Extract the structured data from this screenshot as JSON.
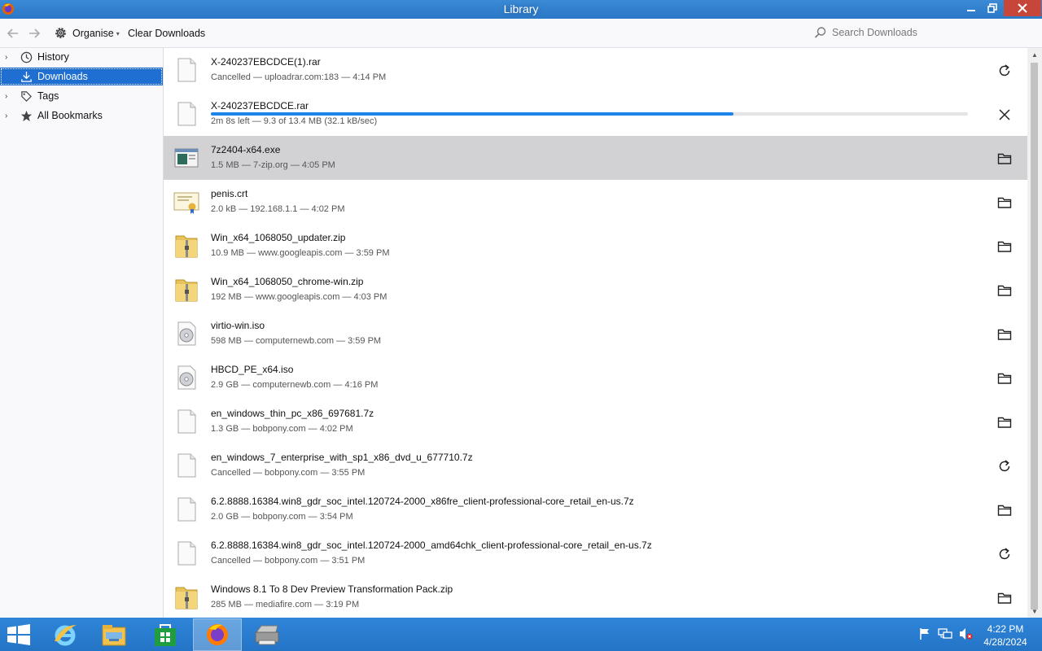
{
  "window": {
    "title": "Library",
    "icon": "firefox-icon",
    "controls": [
      "minimize-icon",
      "maximize-icon",
      "close-icon"
    ]
  },
  "toolbar": {
    "back_icon": "back-arrow-icon",
    "forward_icon": "forward-arrow-icon",
    "organise_label": "Organise",
    "clear_downloads_label": "Clear Downloads",
    "search_placeholder": "Search Downloads"
  },
  "sidebar": {
    "items": [
      {
        "label": "History",
        "icon": "clock-icon",
        "expandable": true,
        "selected": false
      },
      {
        "label": "Downloads",
        "icon": "download-icon",
        "expandable": false,
        "selected": true
      },
      {
        "label": "Tags",
        "icon": "tag-icon",
        "expandable": true,
        "selected": false
      },
      {
        "label": "All Bookmarks",
        "icon": "star-icon",
        "expandable": true,
        "selected": false
      }
    ]
  },
  "downloads": [
    {
      "name": "X-240237EBCDCE(1).rar",
      "status": "Cancelled — uploadrar.com:183 — 4:14 PM",
      "file_icon": "generic-file-icon",
      "action": "retry-icon"
    },
    {
      "name": "X-240237EBCDCE.rar",
      "status": "2m 8s left — 9.3 of 13.4 MB (32.1 kB/sec)",
      "file_icon": "generic-file-icon",
      "action": "cancel-icon",
      "progress": 0.69
    },
    {
      "name": "7z2404-x64.exe",
      "status": "1.5 MB — 7-zip.org — 4:05 PM",
      "file_icon": "exe-file-icon",
      "action": "folder-icon",
      "highlighted": true
    },
    {
      "name": "penis.crt",
      "status": "2.0 kB — 192.168.1.1 — 4:02 PM",
      "file_icon": "certificate-file-icon",
      "action": "folder-icon"
    },
    {
      "name": "Win_x64_1068050_updater.zip",
      "status": "10.9 MB — www.googleapis.com — 3:59 PM",
      "file_icon": "zip-folder-icon",
      "action": "folder-icon"
    },
    {
      "name": "Win_x64_1068050_chrome-win.zip",
      "status": "192 MB — www.googleapis.com — 4:03 PM",
      "file_icon": "zip-folder-icon",
      "action": "folder-icon"
    },
    {
      "name": "virtio-win.iso",
      "status": "598 MB — computernewb.com — 3:59 PM",
      "file_icon": "disc-image-icon",
      "action": "folder-icon"
    },
    {
      "name": "HBCD_PE_x64.iso",
      "status": "2.9 GB — computernewb.com — 4:16 PM",
      "file_icon": "disc-image-icon",
      "action": "folder-icon"
    },
    {
      "name": "en_windows_thin_pc_x86_697681.7z",
      "status": "1.3 GB — bobpony.com — 4:02 PM",
      "file_icon": "generic-file-icon",
      "action": "folder-icon"
    },
    {
      "name": "en_windows_7_enterprise_with_sp1_x86_dvd_u_677710.7z",
      "status": "Cancelled — bobpony.com — 3:55 PM",
      "file_icon": "generic-file-icon",
      "action": "retry-icon"
    },
    {
      "name": "6.2.8888.16384.win8_gdr_soc_intel.120724-2000_x86fre_client-professional-core_retail_en-us.7z",
      "status": "2.0 GB — bobpony.com — 3:54 PM",
      "file_icon": "generic-file-icon",
      "action": "folder-icon"
    },
    {
      "name": "6.2.8888.16384.win8_gdr_soc_intel.120724-2000_amd64chk_client-professional-core_retail_en-us.7z",
      "status": "Cancelled — bobpony.com — 3:51 PM",
      "file_icon": "generic-file-icon",
      "action": "retry-icon"
    },
    {
      "name": "Windows 8.1 To 8 Dev Preview Transformation Pack.zip",
      "status": "285 MB — mediafire.com — 3:19 PM",
      "file_icon": "zip-folder-icon",
      "action": "folder-icon"
    }
  ],
  "taskbar": {
    "start_icon": "windows-start-icon",
    "apps": [
      "internet-explorer-icon",
      "file-explorer-icon",
      "store-icon",
      "firefox-icon",
      "printer-scanner-icon"
    ],
    "active_app": "firefox-icon",
    "tray_icons": [
      "action-center-flag-icon",
      "network-icon",
      "volume-muted-icon"
    ],
    "time": "4:22 PM",
    "date": "4/28/2024"
  },
  "colors": {
    "title_bar": "#2b78c6",
    "selection": "#1e6fd1",
    "progress": "#1e85e8",
    "taskbar": "#2474c6",
    "close_button": "#c7463a"
  }
}
